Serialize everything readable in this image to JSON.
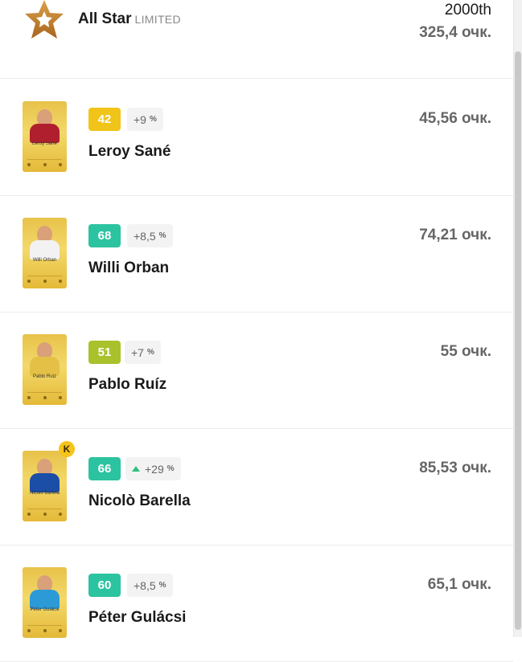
{
  "header": {
    "title": "All Star",
    "tier": "LIMITED",
    "rank": "2000th",
    "total": "325,4 очк."
  },
  "players": [
    {
      "name": "Leroy Sané",
      "card_name": "Leroy Sané",
      "score": "42",
      "score_color": "#f0c419",
      "bonus": "+9",
      "bonus_up": false,
      "points": "45,56 очк.",
      "captain": false,
      "shirt": "#b01f2e"
    },
    {
      "name": "Willi Orban",
      "card_name": "Willi Orban",
      "score": "68",
      "score_color": "#2cc3a0",
      "bonus": "+8,5",
      "bonus_up": false,
      "points": "74,21 очк.",
      "captain": false,
      "shirt": "#f2f2f2"
    },
    {
      "name": "Pablo Ruíz",
      "card_name": "Pablo Ruiz",
      "score": "51",
      "score_color": "#a9c22c",
      "bonus": "+7",
      "bonus_up": false,
      "points": "55 очк.",
      "captain": false,
      "shirt": "#e5c046"
    },
    {
      "name": "Nicolò Barella",
      "card_name": "Nicolò Barella",
      "score": "66",
      "score_color": "#2cc3a0",
      "bonus": "+29",
      "bonus_up": true,
      "points": "85,53 очк.",
      "captain": true,
      "captain_label": "K",
      "shirt": "#1b4ea6"
    },
    {
      "name": "Péter Gulácsi",
      "card_name": "Péter Gulácsi",
      "score": "60",
      "score_color": "#2cc3a0",
      "bonus": "+8,5",
      "bonus_up": false,
      "points": "65,1 очк.",
      "captain": false,
      "shirt": "#2d9ad8"
    }
  ],
  "percent_symbol": "%",
  "icons": {
    "header": "star-badge-icon",
    "bonus_up": "triangle-up-icon"
  }
}
